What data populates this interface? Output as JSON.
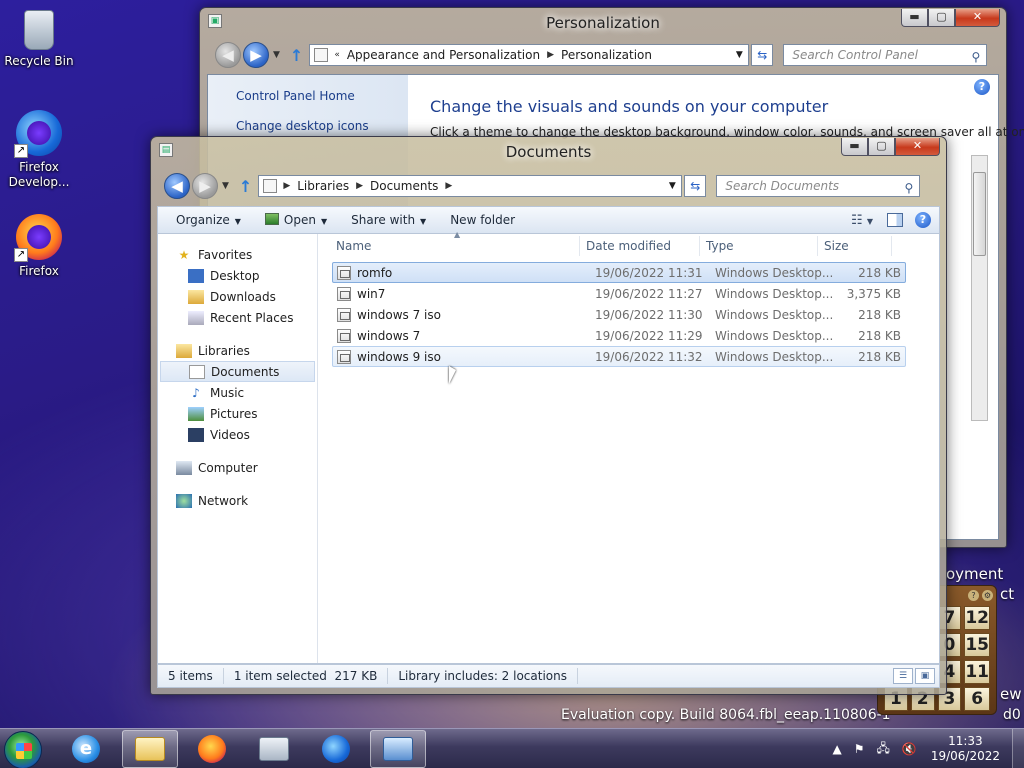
{
  "desktop": {
    "icons": [
      {
        "label": "Recycle Bin"
      },
      {
        "label": "Firefox Develop..."
      },
      {
        "label": "Firefox"
      }
    ],
    "watermark_line1": "oyment",
    "watermark_line1b": "ct",
    "watermark_line2": "ew",
    "watermark_build": "Evaluation copy. Build 8064.fbl_eeap.110806-1",
    "watermark_build_tail": "d0"
  },
  "control_panel": {
    "title": "Personalization",
    "address": [
      "Appearance and Personalization",
      "Personalization"
    ],
    "search_placeholder": "Search Control Panel",
    "left_links": [
      "Control Panel Home",
      "Change desktop icons"
    ],
    "heading": "Change the visuals and sounds on your computer",
    "subtext": "Click a theme to change the desktop background, window color, sounds, and screen saver all at once."
  },
  "explorer": {
    "title": "Documents",
    "address": [
      "Libraries",
      "Documents"
    ],
    "search_placeholder": "Search Documents",
    "commands": {
      "organize": "Organize",
      "open": "Open",
      "share_with": "Share with",
      "new_folder": "New folder"
    },
    "nav": {
      "favorites": {
        "label": "Favorites",
        "items": [
          "Desktop",
          "Downloads",
          "Recent Places"
        ]
      },
      "libraries": {
        "label": "Libraries",
        "items": [
          "Documents",
          "Music",
          "Pictures",
          "Videos"
        ]
      },
      "computer": "Computer",
      "network": "Network"
    },
    "columns": [
      "Name",
      "Date modified",
      "Type",
      "Size"
    ],
    "files": [
      {
        "name": "romfo",
        "date": "19/06/2022 11:31",
        "type": "Windows Desktop...",
        "size": "218 KB"
      },
      {
        "name": "win7",
        "date": "19/06/2022 11:27",
        "type": "Windows Desktop...",
        "size": "3,375 KB"
      },
      {
        "name": "windows 7 iso",
        "date": "19/06/2022 11:30",
        "type": "Windows Desktop...",
        "size": "218 KB"
      },
      {
        "name": "windows 7",
        "date": "19/06/2022 11:29",
        "type": "Windows Desktop...",
        "size": "218 KB"
      },
      {
        "name": "windows 9 iso",
        "date": "19/06/2022 11:32",
        "type": "Windows Desktop...",
        "size": "218 KB"
      }
    ],
    "status": {
      "items": "5 items",
      "selected": "1 item selected",
      "selected_size": "217 KB",
      "library": "Library includes: 2 locations"
    }
  },
  "gadget": {
    "tiles": [
      "",
      "",
      "7",
      "12",
      "",
      "",
      "0",
      "15",
      "",
      "",
      "4",
      "11",
      "1",
      "2",
      "3",
      "6"
    ]
  },
  "taskbar": {
    "time": "11:33",
    "date": "19/06/2022"
  }
}
